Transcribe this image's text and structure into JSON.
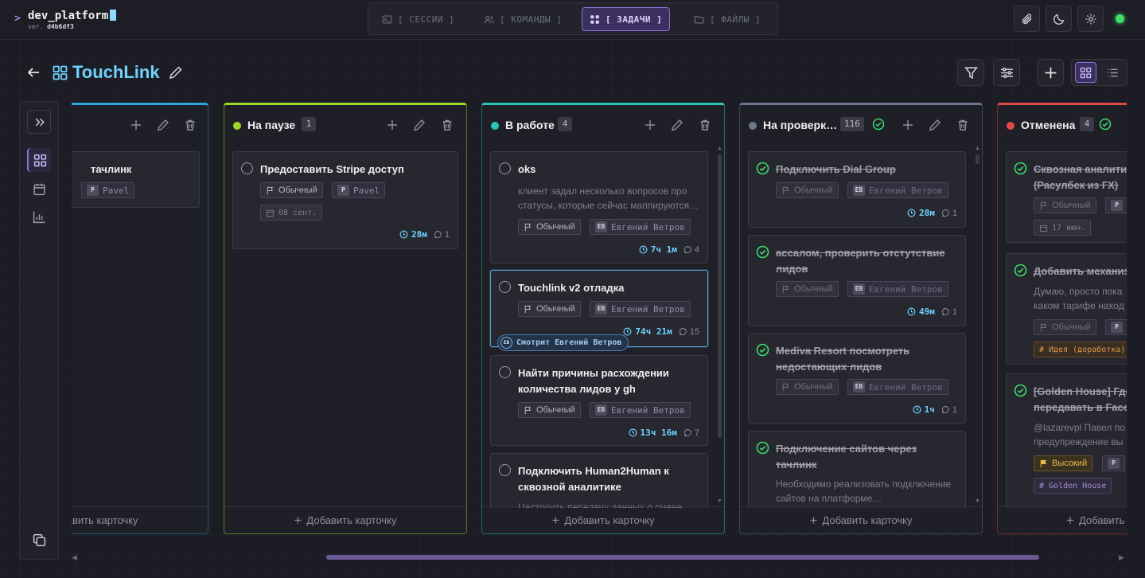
{
  "app": {
    "prompt": ">",
    "name": "dev_platform",
    "version_label": "ver.",
    "version": "d4b6df3"
  },
  "nav": {
    "tabs": [
      {
        "label": "[ СЕССИИ ]",
        "icon": "terminal-icon"
      },
      {
        "label": "[ КОМАНДЫ ]",
        "icon": "users-icon"
      },
      {
        "label": "[ ЗАДАЧИ ]",
        "icon": "grid-icon",
        "active": true
      },
      {
        "label": "[ ФАЙЛЫ ]",
        "icon": "folder-icon"
      }
    ]
  },
  "toolbar": {
    "icons": [
      "paperclip-icon",
      "moon-icon",
      "gear-icon"
    ],
    "status": "online"
  },
  "board": {
    "title": "TouchLink",
    "view": "grid"
  },
  "columns": [
    {
      "id": "partial",
      "color": "#2aa7e0",
      "cards": [
        {
          "title": "тачлинк",
          "assignee_initial": "P",
          "assignee": "Pavel"
        }
      ]
    },
    {
      "id": "paused",
      "title": "На паузе",
      "count": "1",
      "color": "#9ed62a",
      "add_label": "Добавить карточку",
      "cards": [
        {
          "title": "Предоставить Stripe доступ",
          "priority": "Обычный",
          "assignee_initial": "P",
          "assignee": "Pavel",
          "date": "08 сент.",
          "time": "28м",
          "comments": "1"
        }
      ]
    },
    {
      "id": "in-progress",
      "title": "В работе",
      "count": "4",
      "color": "#2bc7b4",
      "add_label": "Добавить карточку",
      "cards": [
        {
          "title": "oks",
          "desc": "клиент задал несколько вопросов про статусы, которые сейчас маппируются…",
          "priority": "Обычный",
          "assignee_initial": "ЕВ",
          "assignee": "Евгений Ветров",
          "time": "7ч 1м",
          "comments": "4"
        },
        {
          "title": "Touchlink v2 отладка",
          "priority": "Обычный",
          "assignee_initial": "ЕВ",
          "assignee": "Евгений Ветров",
          "time": "74ч 21м",
          "comments": "15",
          "watcher_initials": "ЕВ",
          "watcher": "Смотрит Евгений Ветров"
        },
        {
          "title": "Найти причины расхождении количества лидов у gh",
          "priority": "Обычный",
          "assignee_initial": "ЕВ",
          "assignee": "Евгений Ветров",
          "time": "13ч 16м",
          "comments": "7"
        },
        {
          "title": "Подключить Human2Human к сквозной аналитике",
          "desc": "Настроить передачу данных о смене"
        }
      ]
    },
    {
      "id": "review",
      "title": "На проверк…",
      "count": "116",
      "color": "#6c7690",
      "add_label": "Добавить карточку",
      "cards": [
        {
          "title": "Подключить Dial Group",
          "priority": "Обычный",
          "assignee_initial": "ЕВ",
          "assignee": "Евгений Ветров",
          "time": "28м",
          "comments": "1"
        },
        {
          "title": "ассалом, проверить отстутствие лидов",
          "priority": "Обычный",
          "assignee_initial": "ЕВ",
          "assignee": "Евгений Ветров",
          "time": "49м",
          "comments": "1"
        },
        {
          "title": "Mediva Resort посмотреть недостающих лидов",
          "priority": "Обычный",
          "assignee_initial": "ЕВ",
          "assignee": "Евгений Ветров",
          "time": "1ч",
          "comments": "1"
        },
        {
          "title": "Подключение сайтов через тачлинк",
          "desc": "Необходимо реализовать подключение сайтов на платформе…"
        }
      ]
    },
    {
      "id": "cancelled",
      "title": "Отменена",
      "count": "4",
      "color": "#e04848",
      "add_label": "Добавить",
      "cards": [
        {
          "title": "Сквозная аналити (Расулбек из ГХ)",
          "priority": "Обычный",
          "assignee_initial": "P",
          "date": "17 июн."
        },
        {
          "title": "Добавить механиз",
          "desc": "Думаю, просто пока каком тарифе наход",
          "priority": "Обычный",
          "assignee_initial": "P",
          "tag": "# Идея (доработка)"
        },
        {
          "title": "[Golden House] Где передавать в Faceb",
          "desc": "@lazarevpl Павел по предупреждение вы",
          "priority": "Высокий",
          "assignee_initial": "P",
          "tag": "# Golden House"
        }
      ]
    }
  ]
}
